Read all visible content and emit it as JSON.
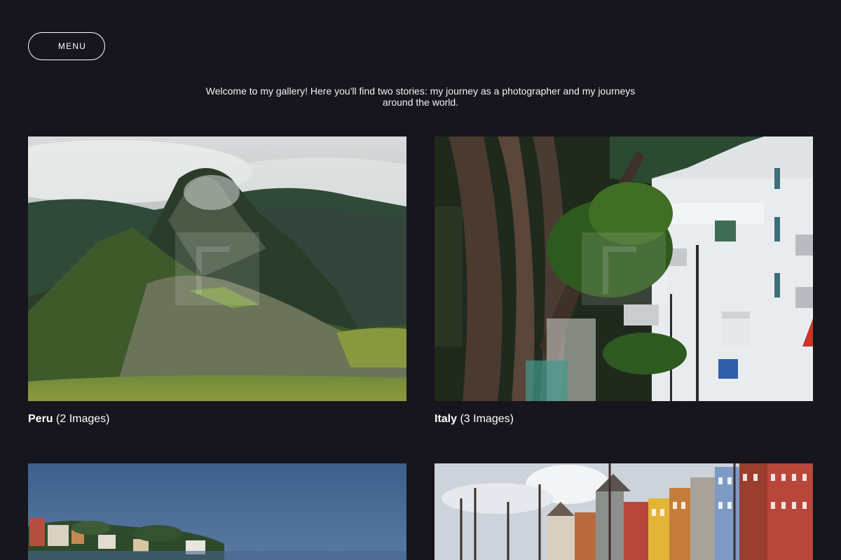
{
  "header": {
    "menu_label": "MENU"
  },
  "intro": {
    "text": "Welcome to my gallery! Here you'll find two stories: my journey as a photographer and my journeys around the world."
  },
  "gallery": {
    "albums": [
      {
        "name": "Peru",
        "count": "(2 Images)"
      },
      {
        "name": "Italy",
        "count": "(3 Images)"
      },
      {
        "name": "",
        "count": ""
      },
      {
        "name": "",
        "count": ""
      }
    ]
  }
}
